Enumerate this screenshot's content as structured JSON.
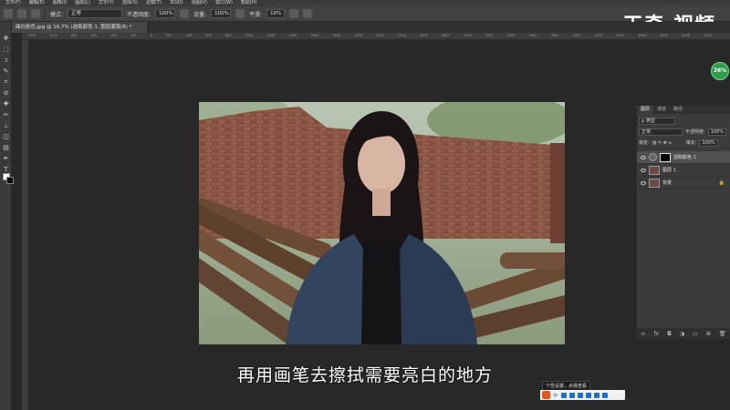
{
  "menu": [
    "文件(F)",
    "编辑(E)",
    "图像(I)",
    "图层(L)",
    "文字(Y)",
    "选择(S)",
    "滤镜(T)",
    "3D(D)",
    "视图(V)",
    "窗口(W)",
    "帮助(H)"
  ],
  "options": {
    "mode_label": "模式:",
    "mode_value": "正常",
    "opacity_label": "不透明度:",
    "opacity_value": "100%",
    "flow_label": "流量:",
    "flow_value": "100%",
    "smooth_label": "平滑:",
    "smooth_value": "10%"
  },
  "brand": "天奇·视频",
  "document_tab": "曲白肤色.jpg @ 16.7% (选取颜色 1, 图层蒙版/8) *",
  "ruler_ticks": [
    "1200",
    "1000",
    "800",
    "600",
    "400",
    "200",
    "0",
    "200",
    "400",
    "600",
    "800",
    "1000",
    "1200",
    "1400",
    "1600",
    "1800",
    "2000",
    "2200",
    "2400",
    "2600",
    "2800",
    "3000",
    "3200",
    "3400",
    "3600",
    "3800",
    "4000",
    "4200",
    "4400",
    "4600",
    "4800",
    "5000",
    "5200"
  ],
  "zoom_badge": "26%",
  "layers_panel": {
    "tabs": [
      "图层",
      "通道",
      "路径"
    ],
    "filter_label": "ρ 类型",
    "blend_mode": "正常",
    "opacity_label": "不透明度:",
    "opacity_value": "100%",
    "lock_label": "锁定:",
    "fill_label": "填充:",
    "fill_value": "100%",
    "layers": [
      {
        "name": "选取颜色 1",
        "selected": true
      },
      {
        "name": "图层 1",
        "selected": false
      },
      {
        "name": "背景",
        "selected": false
      }
    ],
    "footer_icons": [
      "link-icon",
      "fx-icon",
      "mask-icon",
      "adjustment-icon",
      "group-icon",
      "new-layer-icon",
      "trash-icon"
    ]
  },
  "subtitle": "再用画笔去擦拭需要亮白的地方",
  "notification": {
    "tip": "个性设置，点我查看",
    "bar_label": "中"
  }
}
